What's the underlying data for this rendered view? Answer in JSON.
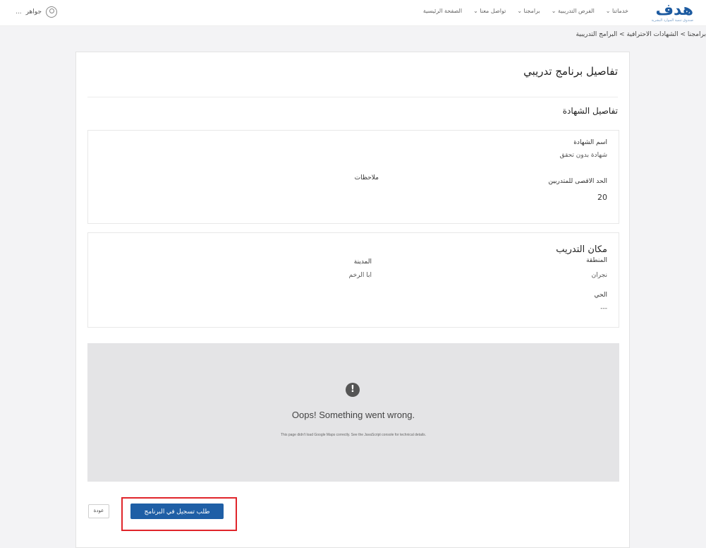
{
  "header": {
    "logo_text": "هدف",
    "logo_subtitle": "صندوق تنمية الموارد البشرية",
    "nav": [
      "الصفحة الرئيسية",
      "تواصل معنا ⌄",
      "برامجنا ⌄",
      "الفرص التدريبية ⌄",
      "خدماتنا ⌄"
    ],
    "user_name": "جواهر",
    "user_more": "..."
  },
  "breadcrumb": "برامجنا > الشهادات الاحترافية > البرامج التدريبية",
  "page": {
    "title": "تفاصيل برنامج تدريبي",
    "section_title": "تفاصيل الشهادة"
  },
  "certificate": {
    "name_label": "اسم الشهادة",
    "name_value": "شهادة بدون تحقق",
    "max_trainees_label": "الحد الاقصى للمتدربين",
    "max_trainees_value": "20",
    "notes_label": "ملاحظات"
  },
  "location": {
    "title": "مكان التدريب",
    "region_label": "المنطقة",
    "region_value": "نجران",
    "city_label": "المدينة",
    "city_value": "ابا الرخم",
    "district_label": "الحي",
    "district_value": "---"
  },
  "map_error": {
    "icon": "alert-icon",
    "title": "Oops! Something went wrong.",
    "message": "This page didn't load Google Maps correctly. See the JavaScript console for technical details."
  },
  "actions": {
    "register_label": "طلب تسجيل في البرنامج",
    "back_label": "عودة"
  },
  "colors": {
    "primary": "#1f5fa6",
    "highlight": "#e0252b"
  }
}
